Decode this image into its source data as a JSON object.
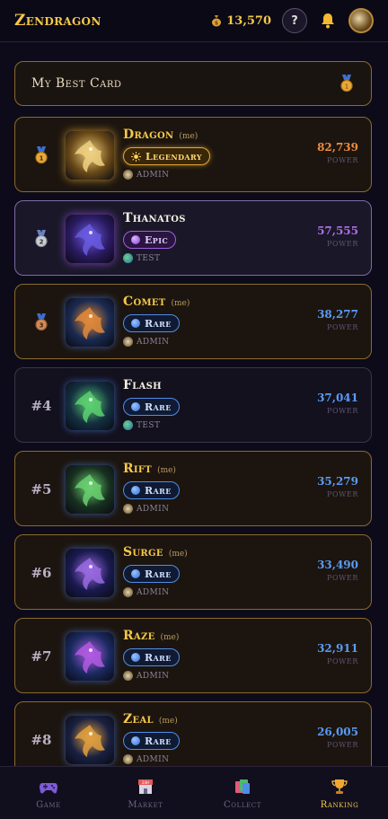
{
  "header": {
    "brand": "Zendragon",
    "coins": "13,570",
    "help_label": "?"
  },
  "best_card": {
    "title": "My Best Card"
  },
  "ranking": [
    {
      "rank": "1",
      "medal": "gold",
      "name": "Dragon",
      "me": "(me)",
      "rarity": "Legendary",
      "owner": "ADMIN",
      "power": "82,739",
      "power_label": "POWER",
      "power_color": "#f08c3c"
    },
    {
      "rank": "2",
      "medal": "silver",
      "name": "Thanatos",
      "me": "",
      "rarity": "Epic",
      "owner": "TEST",
      "power": "57,555",
      "power_label": "POWER",
      "power_color": "#b26ee8"
    },
    {
      "rank": "3",
      "medal": "bronze",
      "name": "Comet",
      "me": "(me)",
      "rarity": "Rare",
      "owner": "ADMIN",
      "power": "38,277",
      "power_label": "POWER",
      "power_color": "#5a9cf5"
    },
    {
      "rank": "#4",
      "medal": "",
      "name": "Flash",
      "me": "",
      "rarity": "Rare",
      "owner": "TEST",
      "power": "37,041",
      "power_label": "POWER",
      "power_color": "#5a9cf5"
    },
    {
      "rank": "#5",
      "medal": "",
      "name": "Rift",
      "me": "(me)",
      "rarity": "Rare",
      "owner": "ADMIN",
      "power": "35,279",
      "power_label": "POWER",
      "power_color": "#5a9cf5"
    },
    {
      "rank": "#6",
      "medal": "",
      "name": "Surge",
      "me": "(me)",
      "rarity": "Rare",
      "owner": "ADMIN",
      "power": "33,490",
      "power_label": "POWER",
      "power_color": "#5a9cf5"
    },
    {
      "rank": "#7",
      "medal": "",
      "name": "Raze",
      "me": "(me)",
      "rarity": "Rare",
      "owner": "ADMIN",
      "power": "32,911",
      "power_label": "POWER",
      "power_color": "#5a9cf5"
    },
    {
      "rank": "#8",
      "medal": "",
      "name": "Zeal",
      "me": "(me)",
      "rarity": "Rare",
      "owner": "ADMIN",
      "power": "26,005",
      "power_label": "POWER",
      "power_color": "#5a9cf5"
    }
  ],
  "nav": [
    {
      "label": "Game",
      "icon": "gamepad-icon",
      "active": false
    },
    {
      "label": "Market",
      "icon": "market-icon",
      "active": false
    },
    {
      "label": "Collect",
      "icon": "cards-icon",
      "active": false
    },
    {
      "label": "Ranking",
      "icon": "trophy-icon",
      "active": true
    }
  ],
  "colors": {
    "gold": "#f5c84a",
    "rare": "#5a9cf5",
    "epic": "#b26ee8",
    "legendary": "#f08c3c"
  }
}
